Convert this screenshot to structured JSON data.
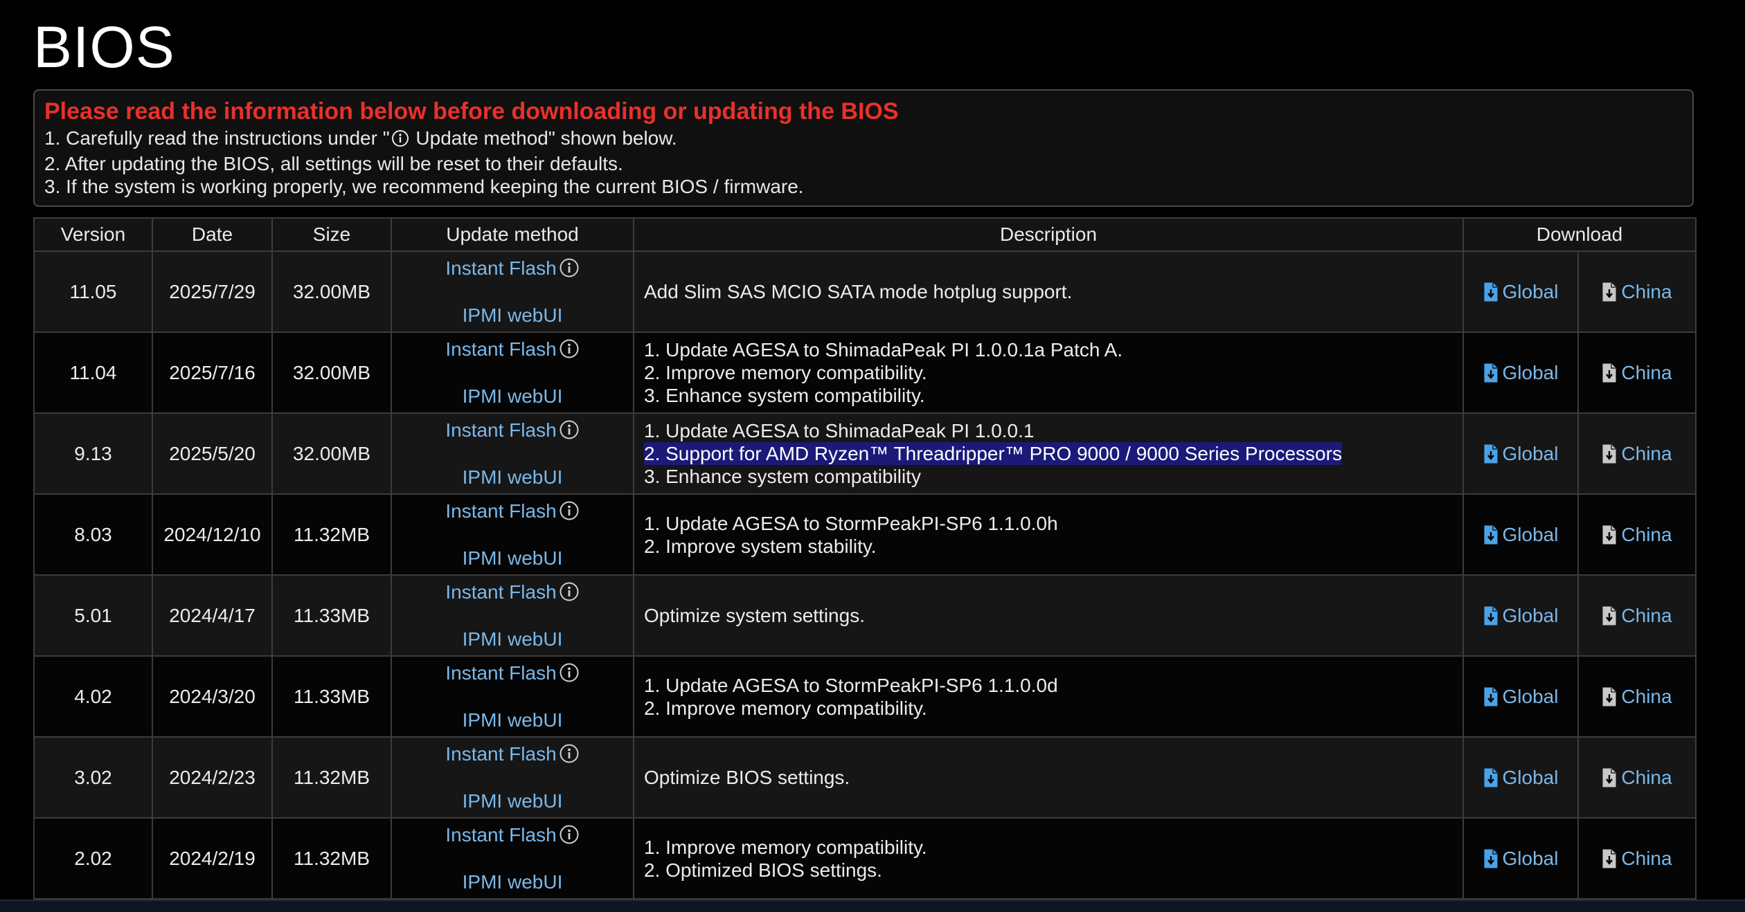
{
  "page": {
    "title": "BIOS"
  },
  "notice": {
    "heading": "Please read the information below before downloading or updating the BIOS",
    "line1_before": "1. Carefully read the instructions under \"",
    "line1_after": " Update method\" shown below.",
    "line2": "2. After updating the BIOS, all settings will be reset to their defaults.",
    "line3": "3. If the system is working properly, we recommend keeping the current BIOS / firmware."
  },
  "table": {
    "headers": [
      "Version",
      "Date",
      "Size",
      "Update method",
      "Description",
      "Download"
    ],
    "method_labels": {
      "instant_flash": "Instant Flash",
      "ipmi": "IPMI webUI"
    },
    "download_labels": {
      "global": "Global",
      "china": "China"
    },
    "rows": [
      {
        "version": "11.05",
        "date": "2025/7/29",
        "size": "32.00MB",
        "description": [
          "Add Slim SAS MCIO SATA mode hotplug support."
        ]
      },
      {
        "version": "11.04",
        "date": "2025/7/16",
        "size": "32.00MB",
        "description": [
          "1. Update AGESA to ShimadaPeak PI 1.0.0.1a Patch A.",
          "2. Improve memory compatibility.",
          "3. Enhance system compatibility."
        ]
      },
      {
        "version": "9.13",
        "date": "2025/5/20",
        "size": "32.00MB",
        "description": [
          "1. Update AGESA to ShimadaPeak PI 1.0.0.1",
          "2. Support for AMD Ryzen™ Threadripper™ PRO 9000 / 9000 Series Processors",
          "3. Enhance system compatibility"
        ]
      },
      {
        "version": "8.03",
        "date": "2024/12/10",
        "size": "11.32MB",
        "description": [
          "1. Update AGESA to StormPeakPI-SP6 1.1.0.0h",
          "2. Improve system stability."
        ]
      },
      {
        "version": "5.01",
        "date": "2024/4/17",
        "size": "11.33MB",
        "description": [
          "Optimize system settings."
        ]
      },
      {
        "version": "4.02",
        "date": "2024/3/20",
        "size": "11.33MB",
        "description": [
          "1. Update AGESA to StormPeakPI-SP6 1.1.0.0d",
          "2. Improve memory compatibility."
        ]
      },
      {
        "version": "3.02",
        "date": "2024/2/23",
        "size": "11.32MB",
        "description": [
          "Optimize BIOS settings."
        ]
      },
      {
        "version": "2.02",
        "date": "2024/2/19",
        "size": "11.32MB",
        "description": [
          "1. Improve memory compatibility.",
          "2. Optimized BIOS settings."
        ]
      }
    ]
  },
  "colors": {
    "background": "#000000",
    "warning_red": "#e8312a",
    "link_blue": "#7ab8ea",
    "selection_highlight": "#1b1a78"
  },
  "icons": {
    "info": "info-circle-icon",
    "global_download": "download-file-icon",
    "china_download": "download-file-icon"
  }
}
